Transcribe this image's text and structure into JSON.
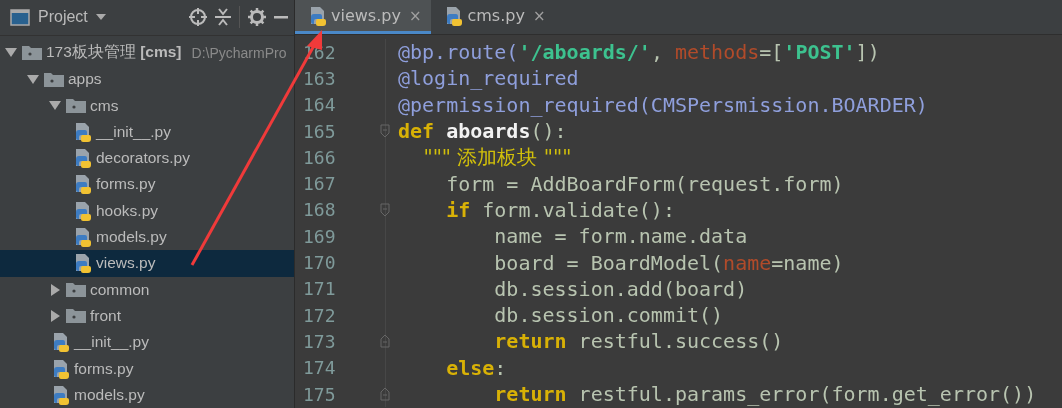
{
  "project_panel": {
    "title": "Project",
    "tree": [
      {
        "kind": "root",
        "label": "173板块管理 **[cms]**",
        "path": "D:\\PycharmPro",
        "expanded": true,
        "selected": false,
        "children": [
          {
            "kind": "folder",
            "label": "apps",
            "expanded": true,
            "selected": false,
            "children": [
              {
                "kind": "folder",
                "label": "cms",
                "expanded": true,
                "selected": false,
                "children": [
                  {
                    "kind": "python",
                    "label": "__init__.py",
                    "selected": false
                  },
                  {
                    "kind": "python",
                    "label": "decorators.py",
                    "selected": false
                  },
                  {
                    "kind": "python",
                    "label": "forms.py",
                    "selected": false
                  },
                  {
                    "kind": "python",
                    "label": "hooks.py",
                    "selected": false
                  },
                  {
                    "kind": "python",
                    "label": "models.py",
                    "selected": false
                  },
                  {
                    "kind": "python",
                    "label": "views.py",
                    "selected": true
                  }
                ]
              },
              {
                "kind": "folder",
                "label": "common",
                "expanded": false,
                "selected": false
              },
              {
                "kind": "folder",
                "label": "front",
                "expanded": false,
                "selected": false
              },
              {
                "kind": "python",
                "label": "__init__.py",
                "selected": false
              },
              {
                "kind": "python",
                "label": "forms.py",
                "selected": false
              },
              {
                "kind": "python",
                "label": "models.py",
                "selected": false
              }
            ]
          }
        ]
      }
    ]
  },
  "editor": {
    "tabs": [
      {
        "label": "views.py",
        "close": "×",
        "selected": true
      },
      {
        "label": "cms.py",
        "close": "×",
        "selected": false
      }
    ],
    "lines": [
      {
        "number": "162",
        "fold_start": false,
        "fold_end": false,
        "tokens": [
          {
            "kind": "decorator",
            "text": "@bp.route("
          },
          {
            "kind": "string",
            "text": "'/aboards/'"
          },
          {
            "kind": "plain",
            "text": ", "
          },
          {
            "kind": "param",
            "text": "methods"
          },
          {
            "kind": "plain",
            "text": "=["
          },
          {
            "kind": "string",
            "text": "'POST'"
          },
          {
            "kind": "plain",
            "text": "])"
          }
        ]
      },
      {
        "number": "163",
        "fold_start": false,
        "fold_end": false,
        "tokens": [
          {
            "kind": "decorator",
            "text": "@login_required"
          }
        ]
      },
      {
        "number": "164",
        "fold_start": false,
        "fold_end": false,
        "tokens": [
          {
            "kind": "decorator",
            "text": "@permission_required(CMSPersmission.BOARDER)"
          }
        ]
      },
      {
        "number": "165",
        "fold_start": true,
        "fold_end": false,
        "tokens": [
          {
            "kind": "keyword",
            "text": "def"
          },
          {
            "kind": "function",
            "text": " aboards"
          },
          {
            "kind": "plain",
            "text": "():"
          }
        ]
      },
      {
        "number": "166",
        "fold_start": false,
        "fold_end": false,
        "tokens": [
          {
            "kind": "docstring",
            "text": "    \"\"\" 添加板块 \"\"\""
          }
        ]
      },
      {
        "number": "167",
        "fold_start": false,
        "fold_end": false,
        "tokens": [
          {
            "kind": "plain",
            "text": "    form = AddBoardForm(request.form)"
          }
        ]
      },
      {
        "number": "168",
        "fold_start": true,
        "fold_end": false,
        "tokens": [
          {
            "kind": "keyword",
            "text": "    if"
          },
          {
            "kind": "plain",
            "text": " form.validate():"
          }
        ]
      },
      {
        "number": "169",
        "fold_start": false,
        "fold_end": false,
        "tokens": [
          {
            "kind": "plain",
            "text": "        name = form.name.data"
          }
        ]
      },
      {
        "number": "170",
        "fold_start": false,
        "fold_end": false,
        "tokens": [
          {
            "kind": "plain",
            "text": "        board = BoardModel("
          },
          {
            "kind": "param",
            "text": "name"
          },
          {
            "kind": "plain",
            "text": "=name)"
          }
        ]
      },
      {
        "number": "171",
        "fold_start": false,
        "fold_end": false,
        "tokens": [
          {
            "kind": "plain",
            "text": "        db.session.add(board)"
          }
        ]
      },
      {
        "number": "172",
        "fold_start": false,
        "fold_end": false,
        "tokens": [
          {
            "kind": "plain",
            "text": "        db.session.commit()"
          }
        ]
      },
      {
        "number": "173",
        "fold_start": false,
        "fold_end": true,
        "tokens": [
          {
            "kind": "keyword",
            "text": "        return"
          },
          {
            "kind": "plain",
            "text": " restful.success()"
          }
        ]
      },
      {
        "number": "174",
        "fold_start": false,
        "fold_end": false,
        "tokens": [
          {
            "kind": "keyword",
            "text": "    else"
          },
          {
            "kind": "plain",
            "text": ":"
          }
        ]
      },
      {
        "number": "175",
        "fold_start": false,
        "fold_end": true,
        "tokens": [
          {
            "kind": "keyword",
            "text": "        return"
          },
          {
            "kind": "plain",
            "text": " restful.params_error(form.get_error())"
          }
        ]
      }
    ]
  }
}
